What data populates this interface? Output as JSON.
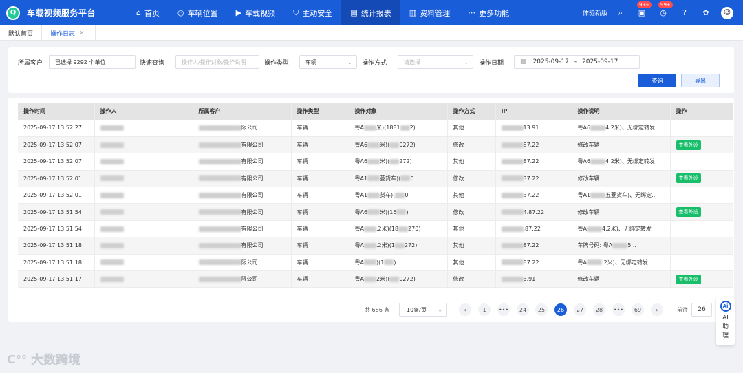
{
  "header": {
    "title": "车载视频服务平台",
    "nav": [
      {
        "label": "首页",
        "icon": "home-icon",
        "glyph": "⌂"
      },
      {
        "label": "车辆位置",
        "icon": "location-pin-icon",
        "glyph": "◎"
      },
      {
        "label": "车载视频",
        "icon": "video-camera-icon",
        "glyph": "▶"
      },
      {
        "label": "主动安全",
        "icon": "shield-icon",
        "glyph": "⛉"
      },
      {
        "label": "统计报表",
        "icon": "chart-icon",
        "glyph": "▤"
      },
      {
        "label": "资料管理",
        "icon": "folder-icon",
        "glyph": "▥"
      },
      {
        "label": "更多功能",
        "icon": "more-icon",
        "glyph": "⋯"
      }
    ],
    "active_nav": "统计报表",
    "trial_label": "体验新版",
    "badge_msg": "99+",
    "badge_alarm": "99+"
  },
  "tabs": [
    {
      "label": "默认首页"
    },
    {
      "label": "操作日志",
      "close": "×"
    }
  ],
  "filter": {
    "customer_label": "所属客户",
    "customer_value": "已选择 9292 个单位",
    "quick_label": "快速查询",
    "quick_placeholder": "操作人/操作对象/操作说明",
    "type_label": "操作类型",
    "type_value": "车辆",
    "method_label": "操作方式",
    "method_placeholder": "请选择",
    "date_label": "操作日期",
    "date_start": "2025-09-17",
    "date_sep": "-",
    "date_end": "2025-09-17",
    "query_label": "查询",
    "export_label": "导出"
  },
  "table": {
    "columns": [
      "操作时间",
      "操作人",
      "所属客户",
      "操作类型",
      "操作对象",
      "操作方式",
      "IP",
      "操作说明",
      "操作"
    ],
    "rows": [
      {
        "time": "2025-09-17 13:52:27",
        "customer": "限公司",
        "type": "车辆",
        "obj_a": "粤A",
        "obj_b": "米)(1881",
        "obj_c": "2)",
        "method": "其他",
        "ip": "13.91",
        "desc_a": "粤A6",
        "desc_b": "4.2米)、无绑定转发",
        "action": ""
      },
      {
        "time": "2025-09-17 13:52:07",
        "customer": "有限公司",
        "type": "车辆",
        "obj_a": "粤A6",
        "obj_b": "米)(",
        "obj_c": "0272)",
        "method": "修改",
        "ip": "87.22",
        "desc_a": "修改车辆",
        "desc_b": "",
        "action": "查看外设"
      },
      {
        "time": "2025-09-17 13:52:07",
        "customer": "有限公司",
        "type": "车辆",
        "obj_a": "粤A6",
        "obj_b": "米)(",
        "obj_c": "272)",
        "method": "其他",
        "ip": "87.22",
        "desc_a": "粤A6",
        "desc_b": "4.2米)、无绑定转发",
        "action": ""
      },
      {
        "time": "2025-09-17 13:52:01",
        "customer": "有限公司",
        "type": "车辆",
        "obj_a": "粤A1",
        "obj_b": "菱货车)(",
        "obj_c": "0",
        "method": "修改",
        "ip": "37.22",
        "desc_a": "修改车辆",
        "desc_b": "",
        "action": "查看外设"
      },
      {
        "time": "2025-09-17 13:52:01",
        "customer": "有限公司",
        "type": "车辆",
        "obj_a": "粤A1",
        "obj_b": "货车)(",
        "obj_c": "0",
        "method": "其他",
        "ip": "37.22",
        "desc_a": "粤A1",
        "desc_b": "五菱货车)、无绑定...",
        "action": ""
      },
      {
        "time": "2025-09-17 13:51:54",
        "customer": "有限公司",
        "type": "车辆",
        "obj_a": "粤A6",
        "obj_b": "米)(16",
        "obj_c": ")",
        "method": "修改",
        "ip": "4.87.22",
        "desc_a": "修改车辆",
        "desc_b": "",
        "action": "查看外设"
      },
      {
        "time": "2025-09-17 13:51:54",
        "customer": "有限公司",
        "type": "车辆",
        "obj_a": "粤A",
        "obj_b": ".2米)(18",
        "obj_c": "270)",
        "method": "其他",
        "ip": ".87.22",
        "desc_a": "粤A",
        "desc_b": "4.2米)、无绑定转发",
        "action": ""
      },
      {
        "time": "2025-09-17 13:51:18",
        "customer": "有限公司",
        "type": "车辆",
        "obj_a": "粤A",
        "obj_b": ".2米)(1",
        "obj_c": "272)",
        "method": "其他",
        "ip": "87.22",
        "desc_a": "车牌号码: 粤A",
        "desc_b": "5...",
        "action": ""
      },
      {
        "time": "2025-09-17 13:51:18",
        "customer": "限公司",
        "type": "车辆",
        "obj_a": "粤A",
        "obj_b": ")(1",
        "obj_c": ")",
        "method": "其他",
        "ip": "87.22",
        "desc_a": "粤A",
        "desc_b": ".2米)、无绑定转发",
        "action": ""
      },
      {
        "time": "2025-09-17 13:51:17",
        "customer": "限公司",
        "type": "车辆",
        "obj_a": "粤A",
        "obj_b": "2米)(",
        "obj_c": "0272)",
        "method": "修改",
        "ip": "3.91",
        "desc_a": "修改车辆",
        "desc_b": "",
        "action": "查看外设"
      }
    ]
  },
  "pager": {
    "total": "共 686 条",
    "size": "10条/页",
    "prev": "‹",
    "next": "›",
    "pages": [
      "1",
      "•••",
      "24",
      "25",
      "26",
      "27",
      "28",
      "•••",
      "69"
    ],
    "current": "26",
    "goto_label": "前往",
    "goto_value": "26"
  },
  "ai": {
    "badge": "Ai",
    "chars": [
      "AI",
      "助",
      "理"
    ]
  },
  "watermark": {
    "text": "大数跨境"
  }
}
